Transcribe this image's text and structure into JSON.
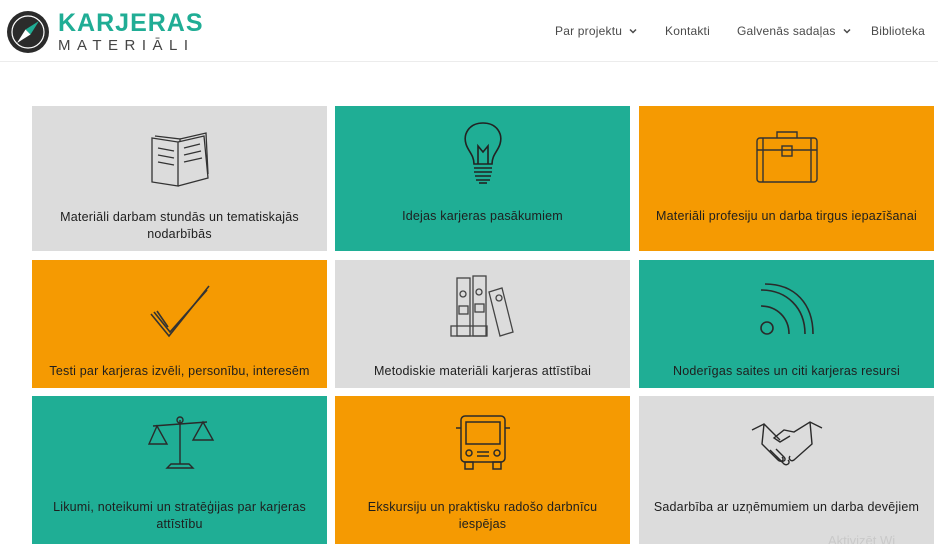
{
  "logo": {
    "line1": "KARJERAS",
    "line2": "MATERIĀLI"
  },
  "nav": [
    {
      "label": "Par projektu",
      "has_dropdown": true
    },
    {
      "label": "Kontakti",
      "has_dropdown": false
    },
    {
      "label": "Galvenās sadaļas",
      "has_dropdown": true
    },
    {
      "label": "Biblioteka",
      "has_dropdown": false
    }
  ],
  "tiles": [
    {
      "label": "Materiāli darbam stundās un tematiskajās nodarbībās",
      "color": "#dcdcdc",
      "icon": "open-book-icon"
    },
    {
      "label": "Idejas karjeras pasākumiem",
      "color": "#1fae95",
      "icon": "lightbulb-icon"
    },
    {
      "label": "Materiāli profesiju un darba tirgus iepazīšanai",
      "color": "#f59a02",
      "icon": "briefcase-icon"
    },
    {
      "label": "Testi par karjeras izvēli, personību, interesēm",
      "color": "#f59a02",
      "icon": "checkmark-icon"
    },
    {
      "label": "Metodiskie materiāli karjeras attīstībai",
      "color": "#dcdcdc",
      "icon": "binders-icon"
    },
    {
      "label": "Noderīgas saites un citi karjeras resursi",
      "color": "#1fae95",
      "icon": "rss-feed-icon"
    },
    {
      "label": "Likumi, noteikumi un stratēģijas par karjeras attīstību",
      "color": "#1fae95",
      "icon": "scales-icon"
    },
    {
      "label": "Ekskursiju un praktisku radošo darbnīcu iespējas",
      "color": "#f59a02",
      "icon": "bus-icon"
    },
    {
      "label": "Sadarbība ar uzņēmumiem un darba devējiem",
      "color": "#dcdcdc",
      "icon": "handshake-icon"
    }
  ],
  "watermark": "Aktivizēt Wi"
}
